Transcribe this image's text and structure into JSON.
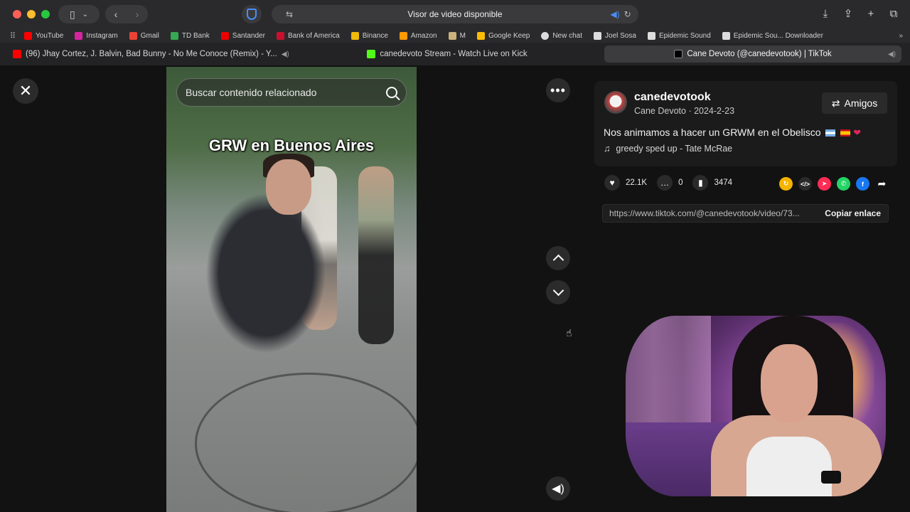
{
  "browser": {
    "address_title": "Visor de video disponible",
    "bookmarks": [
      {
        "label": "YouTube",
        "color": "#ff0000"
      },
      {
        "label": "Instagram",
        "color": "#d6249f"
      },
      {
        "label": "Gmail",
        "color": "#ea4335"
      },
      {
        "label": "TD Bank",
        "color": "#34a853"
      },
      {
        "label": "Santander",
        "color": "#ec0000"
      },
      {
        "label": "Bank of America",
        "color": "#c8102e"
      },
      {
        "label": "Binance",
        "color": "#f0b90b"
      },
      {
        "label": "Amazon",
        "color": "#ff9900"
      },
      {
        "label": "M",
        "color": "#c9b27c"
      },
      {
        "label": "Google Keep",
        "color": "#fbbc04"
      },
      {
        "label": "New chat",
        "color": "#ffffff"
      },
      {
        "label": "Joel Sosa",
        "color": "#ffffff"
      },
      {
        "label": "Epidemic Sound",
        "color": "#ffffff"
      },
      {
        "label": "Epidemic Sou... Downloader",
        "color": "#ffffff"
      }
    ],
    "tabs": [
      {
        "label": "(96) Jhay Cortez, J. Balvin, Bad Bunny - No Me Conoce (Remix) - Y...",
        "color": "#ff0000",
        "active": false
      },
      {
        "label": "canedevoto Stream - Watch Live on Kick",
        "color": "#53fc18",
        "active": false
      },
      {
        "label": "Cane Devoto (@canedevotook) | TikTok",
        "color": "#000000",
        "active": true
      }
    ]
  },
  "video": {
    "search_placeholder": "Buscar contenido relacionado",
    "caption": "GRW en Buenos Aires"
  },
  "post": {
    "username": "canedevotook",
    "display_name": "Cane Devoto",
    "date": "2024-2-23",
    "friends_button": "Amigos",
    "description": "Nos animamos a hacer un GRWM en el Obelisco",
    "music": "greedy sped up - Tate McRae",
    "likes": "22.1K",
    "comments": "0",
    "saves": "3474",
    "link": "https://www.tiktok.com/@canedevotook/video/73...",
    "copy_button": "Copiar enlace"
  }
}
